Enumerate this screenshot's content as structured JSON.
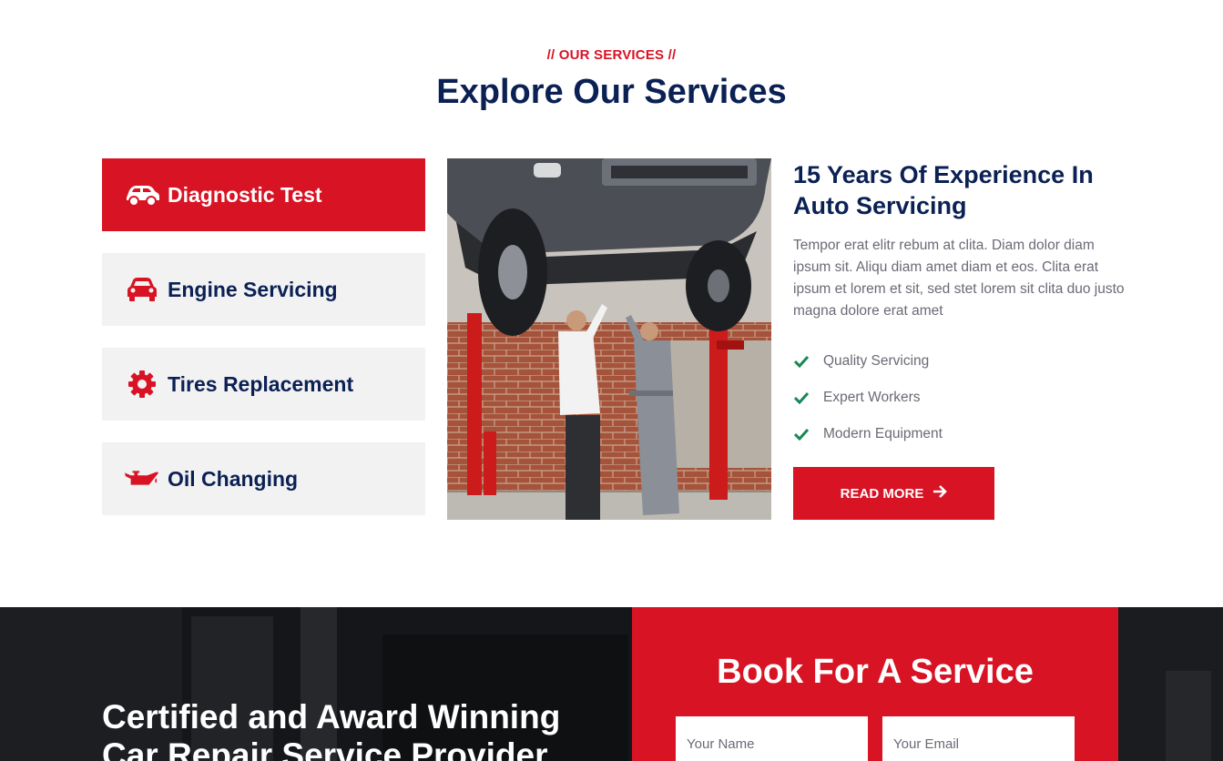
{
  "services": {
    "eyebrow": "// OUR SERVICES //",
    "title": "Explore Our Services",
    "tabs": [
      {
        "label": "Diagnostic Test",
        "icon": "car-side-icon",
        "active": true
      },
      {
        "label": "Engine Servicing",
        "icon": "car-front-icon",
        "active": false
      },
      {
        "label": "Tires Replacement",
        "icon": "cog-icon",
        "active": false
      },
      {
        "label": "Oil Changing",
        "icon": "oil-can-icon",
        "active": false
      }
    ],
    "detail": {
      "title": "15 Years Of Experience In Auto Servicing",
      "text": "Tempor erat elitr rebum at clita. Diam dolor diam ipsum sit. Aliqu diam amet diam et eos. Clita erat ipsum et lorem et sit, sed stet lorem sit clita duo justo magna dolore erat amet",
      "checklist": [
        "Quality Servicing",
        "Expert Workers",
        "Modern Equipment"
      ],
      "button": "READ MORE"
    }
  },
  "booking_section": {
    "heading": "Certified and Award Winning Car Repair Service Provider",
    "form_title": "Book For A Service",
    "name_placeholder": "Your Name",
    "email_placeholder": "Your Email"
  },
  "colors": {
    "accent": "#d81324",
    "navy": "#0b2154",
    "check": "#198754",
    "muted": "#6b6a75"
  }
}
